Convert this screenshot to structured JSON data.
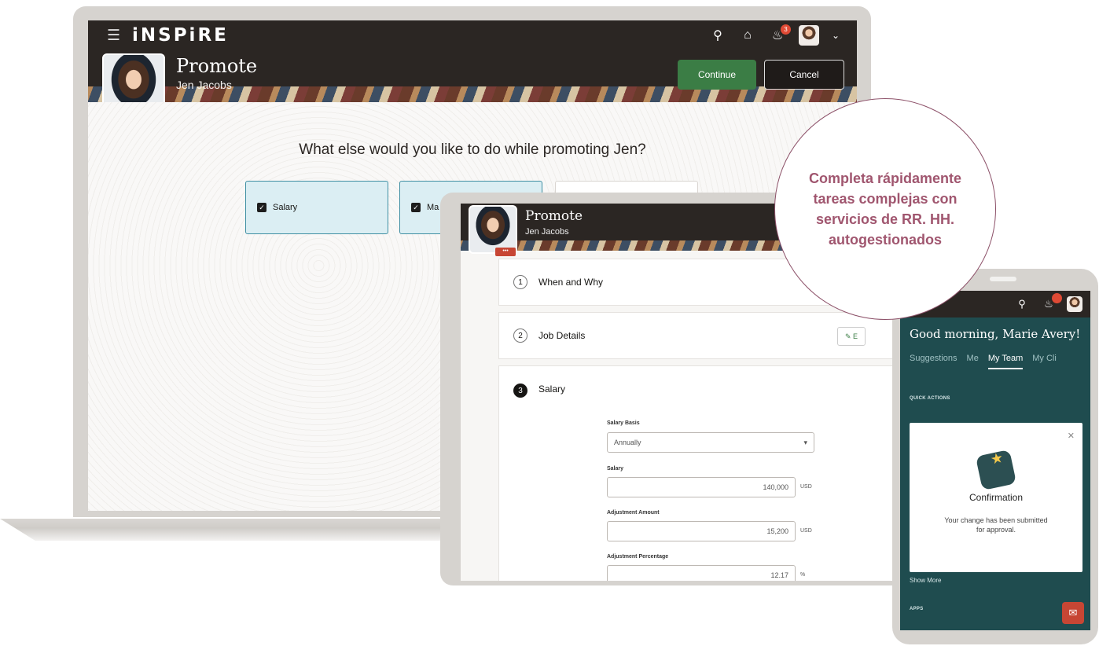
{
  "laptop": {
    "brand": "iNSPiRE",
    "header": {
      "title": "Promote",
      "subtitle": "Jen Jacobs",
      "continue_label": "Continue",
      "cancel_label": "Cancel",
      "badge_count": "3"
    },
    "question": "What else would you like to do while promoting Jen?",
    "options": [
      {
        "label": "Salary",
        "checked": true
      },
      {
        "label": "Ma",
        "checked": true
      },
      {
        "label": "",
        "checked": false
      }
    ]
  },
  "tablet": {
    "header": {
      "title": "Promote",
      "subtitle": "Jen Jacobs"
    },
    "steps": [
      {
        "num": "1",
        "label": "When and Why"
      },
      {
        "num": "2",
        "label": "Job Details",
        "edit": "E"
      },
      {
        "num": "3",
        "label": "Salary"
      }
    ],
    "form": {
      "salary_basis_label": "Salary Basis",
      "salary_basis_value": "Annually",
      "salary_label": "Salary",
      "salary_value": "140,000",
      "salary_unit": "USD",
      "adjustment_amount_label": "Adjustment Amount",
      "adjustment_amount_value": "15,200",
      "adjustment_amount_unit": "USD",
      "adjustment_percentage_label": "Adjustment Percentage",
      "adjustment_percentage_value": "12.17",
      "adjustment_percentage_unit": "%"
    }
  },
  "phone": {
    "greeting": "Good morning, Marie Avery!",
    "tabs": [
      "Suggestions",
      "Me",
      "My Team",
      "My Cli"
    ],
    "quick_actions_label": "QUICK ACTIONS",
    "modal": {
      "title": "Confirmation",
      "text": "Your change has been submitted for approval."
    },
    "show_more": "Show More",
    "apps_label": "APPS"
  },
  "callout": "Completa rápidamente tareas complejas con servicios de RR. HH. autogestionados",
  "colors": {
    "accent_green": "#3b7d45",
    "brand_red": "#c74634",
    "callout_text": "#a0566f",
    "phone_bg": "#1f4c4f"
  }
}
